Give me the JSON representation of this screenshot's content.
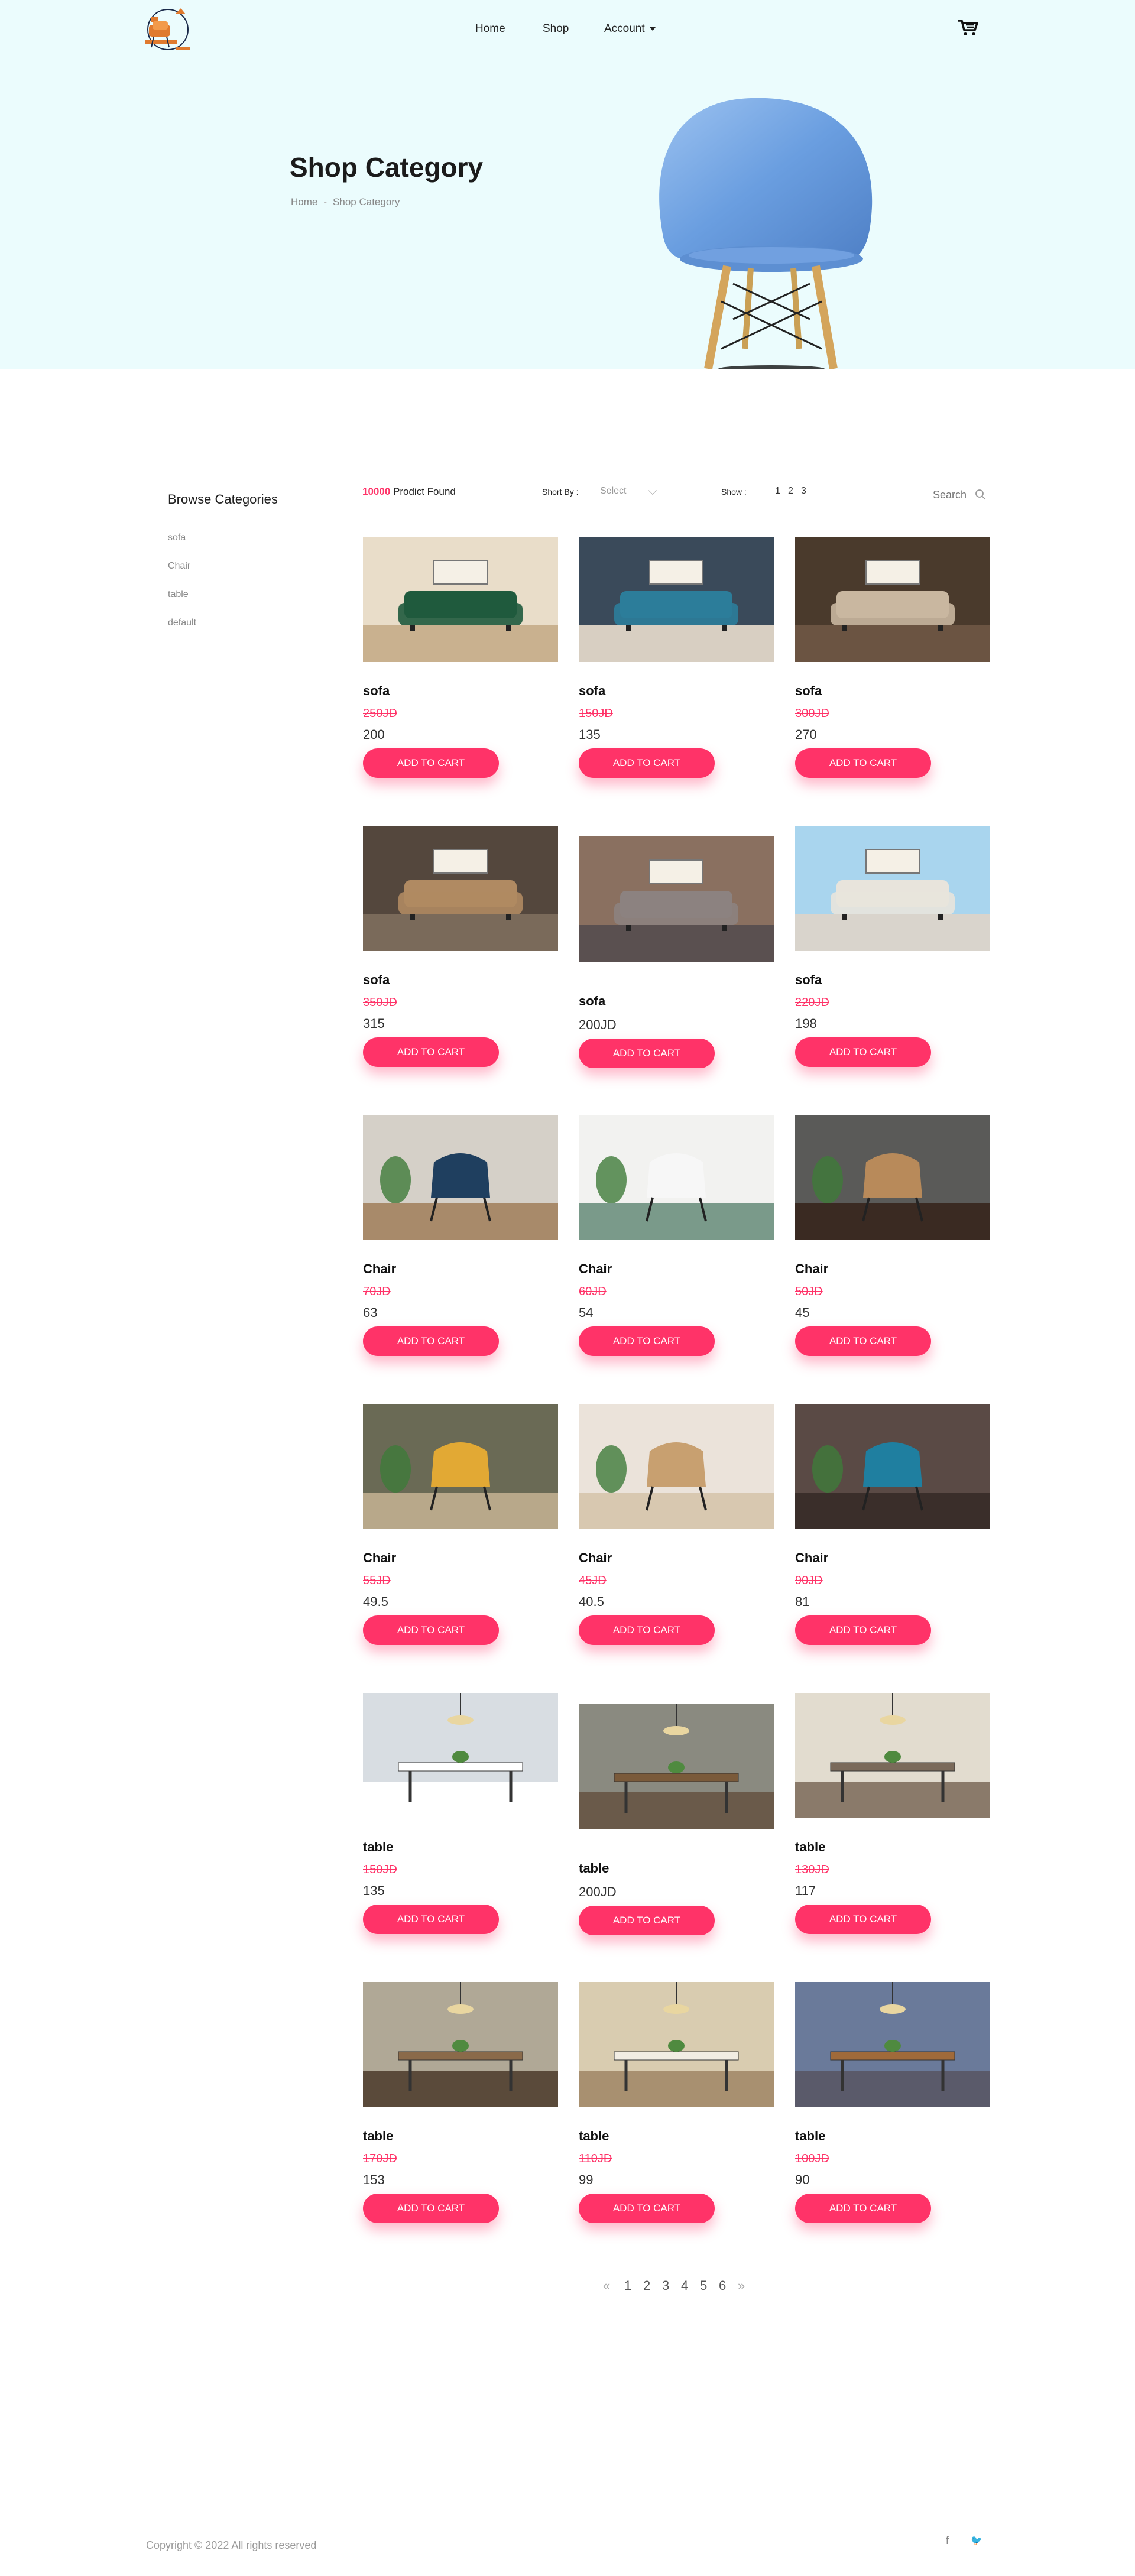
{
  "nav": {
    "home": "Home",
    "shop": "Shop",
    "account": "Account"
  },
  "icons": {
    "logo": "armchair-logo",
    "cart": "cart-icon",
    "search": "search-icon",
    "sort": "chevron-down-icon",
    "facebook": "facebook-icon",
    "twitter": "twitter-icon"
  },
  "hero": {
    "title": "Shop Category",
    "breadcrumb": [
      "Home",
      "Shop Category"
    ]
  },
  "sidebar": {
    "title": "Browse Categories",
    "items": [
      "sofa",
      "Chair",
      "table",
      "default"
    ]
  },
  "toolbar": {
    "count": "10000",
    "found_label": "Prodict Found",
    "sort_label": "Short By :",
    "sort_value": "Select",
    "show_label": "Show :",
    "show_options": [
      "1",
      "2",
      "3"
    ],
    "search_placeholder": "Search"
  },
  "colors": {
    "accent": "#ff3368",
    "hero_bg": "#ebfcfd"
  },
  "products": [
    {
      "name": "sofa",
      "old": "250JD",
      "price": "200",
      "button": "ADD TO CART"
    },
    {
      "name": "sofa",
      "old": "150JD",
      "price": "135",
      "button": "ADD TO CART"
    },
    {
      "name": "sofa",
      "old": "300JD",
      "price": "270",
      "button": "ADD TO CART"
    },
    {
      "name": "sofa",
      "old": "350JD",
      "price": "315",
      "button": "ADD TO CART"
    },
    {
      "name": "sofa",
      "old": "",
      "price": "200JD",
      "button": "ADD TO CART"
    },
    {
      "name": "sofa",
      "old": "220JD",
      "price": "198",
      "button": "ADD TO CART"
    },
    {
      "name": "Chair",
      "old": "70JD",
      "price": "63",
      "button": "ADD TO CART"
    },
    {
      "name": "Chair",
      "old": "60JD",
      "price": "54",
      "button": "ADD TO CART"
    },
    {
      "name": "Chair",
      "old": "50JD",
      "price": "45",
      "button": "ADD TO CART"
    },
    {
      "name": "Chair",
      "old": "55JD",
      "price": "49.5",
      "button": "ADD TO CART"
    },
    {
      "name": "Chair",
      "old": "45JD",
      "price": "40.5",
      "button": "ADD TO CART"
    },
    {
      "name": "Chair",
      "old": "90JD",
      "price": "81",
      "button": "ADD TO CART"
    },
    {
      "name": "table",
      "old": "150JD",
      "price": "135",
      "button": "ADD TO CART"
    },
    {
      "name": "table",
      "old": "",
      "price": "200JD",
      "button": "ADD TO CART"
    },
    {
      "name": "table",
      "old": "130JD",
      "price": "117",
      "button": "ADD TO CART"
    },
    {
      "name": "table",
      "old": "170JD",
      "price": "153",
      "button": "ADD TO CART"
    },
    {
      "name": "table",
      "old": "110JD",
      "price": "99",
      "button": "ADD TO CART"
    },
    {
      "name": "table",
      "old": "100JD",
      "price": "90",
      "button": "ADD TO CART"
    }
  ],
  "pagination": {
    "prev": "«",
    "pages": [
      "1",
      "2",
      "3",
      "4",
      "5",
      "6"
    ],
    "next": "»"
  },
  "footer": {
    "copyright": "Copyright © 2022 All rights reserved",
    "social": [
      "f",
      "🐦"
    ]
  }
}
